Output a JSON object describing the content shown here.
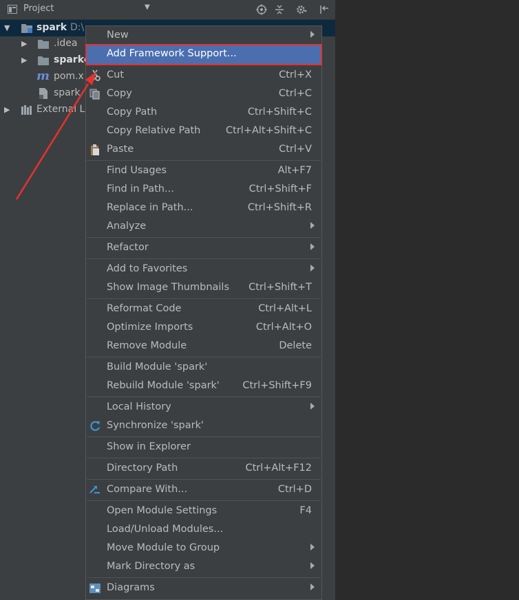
{
  "toolbar": {
    "title": "Project",
    "dropdown": "▼"
  },
  "tree": {
    "root_name": "spark",
    "root_path": "D:\\",
    "idea": ".idea",
    "sparkc": "sparkc",
    "pomx": "pom.x",
    "spark_file": "spark",
    "external": "External L"
  },
  "menu": {
    "new": "New",
    "add_framework": "Add Framework Support...",
    "cut": "Cut",
    "cut_sc": "Ctrl+X",
    "copy": "Copy",
    "copy_sc": "Ctrl+C",
    "copy_path": "Copy Path",
    "copy_path_sc": "Ctrl+Shift+C",
    "copy_rel": "Copy Relative Path",
    "copy_rel_sc": "Ctrl+Alt+Shift+C",
    "paste": "Paste",
    "paste_sc": "Ctrl+V",
    "find_usages": "Find Usages",
    "find_usages_sc": "Alt+F7",
    "find_path": "Find in Path...",
    "find_path_sc": "Ctrl+Shift+F",
    "replace_path": "Replace in Path...",
    "replace_path_sc": "Ctrl+Shift+R",
    "analyze": "Analyze",
    "refactor": "Refactor",
    "add_fav": "Add to Favorites",
    "thumbs": "Show Image Thumbnails",
    "thumbs_sc": "Ctrl+Shift+T",
    "reformat": "Reformat Code",
    "reformat_sc": "Ctrl+Alt+L",
    "optimize": "Optimize Imports",
    "optimize_sc": "Ctrl+Alt+O",
    "remove_module": "Remove Module",
    "remove_module_sc": "Delete",
    "build": "Build Module 'spark'",
    "rebuild": "Rebuild Module 'spark'",
    "rebuild_sc": "Ctrl+Shift+F9",
    "local_history": "Local History",
    "sync": "Synchronize 'spark'",
    "explorer": "Show in Explorer",
    "dir_path": "Directory Path",
    "dir_path_sc": "Ctrl+Alt+F12",
    "compare": "Compare With...",
    "compare_sc": "Ctrl+D",
    "open_settings": "Open Module Settings",
    "open_settings_sc": "F4",
    "load_unload": "Load/Unload Modules...",
    "move_group": "Move Module to Group",
    "mark_dir": "Mark Directory as",
    "diagrams": "Diagrams"
  },
  "colors": {
    "highlight": "#4b6eaf",
    "annotation": "#e8312f",
    "panel_bg": "#3c3f41",
    "editor_bg": "#2b2b2b"
  }
}
